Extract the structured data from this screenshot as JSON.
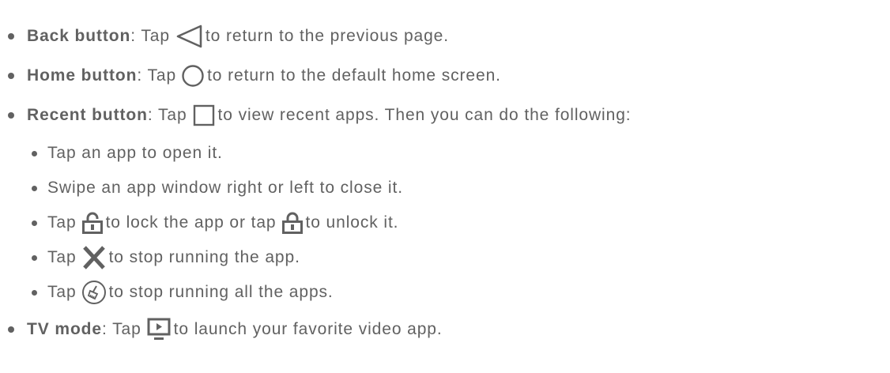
{
  "items": [
    {
      "bold": "Back button",
      "colon": ":",
      "pre": " Tap",
      "icon": "back-triangle-icon",
      "post": "to return to the previous page."
    },
    {
      "bold": "Home button",
      "colon": ":",
      "pre": " Tap",
      "icon": "home-circle-icon",
      "post": "to return to the default home screen."
    },
    {
      "bold": "Recent button",
      "colon": ":",
      "pre": " Tap",
      "icon": "recent-square-icon",
      "post": "to view recent apps. Then you can do the following:"
    },
    {
      "bold": "TV mode",
      "colon": ":",
      "pre": " Tap",
      "icon": "tv-mode-icon",
      "post": "to launch your favorite video app."
    }
  ],
  "subitems": [
    {
      "text": "Tap an app to open it."
    },
    {
      "text": "Swipe an app window right or left to close it."
    },
    {
      "pre": "Tap",
      "icon": "lock-icon",
      "mid": "to lock the app or tap",
      "icon2": "unlock-icon",
      "post": "to unlock it."
    },
    {
      "pre": "Tap",
      "icon": "close-x-icon",
      "post": "to stop running the app."
    },
    {
      "pre": "Tap",
      "icon": "clear-all-broom-icon",
      "post": "to stop running all the apps."
    }
  ]
}
